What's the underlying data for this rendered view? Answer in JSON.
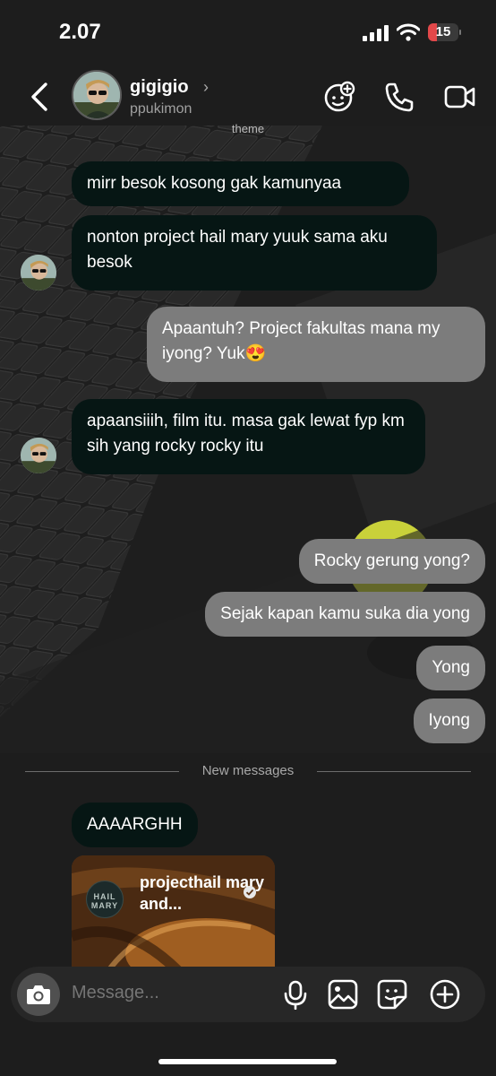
{
  "status_bar": {
    "time": "2.07",
    "battery": "15"
  },
  "header": {
    "username": "gigigio",
    "chevron": "›",
    "handle": "ppukimon"
  },
  "theme_notice": "theme",
  "messages": [
    {
      "side": "in",
      "text": "mirr besok kosong gak kamunyaa"
    },
    {
      "side": "in",
      "text": "nonton project hail mary yuuk sama aku besok"
    },
    {
      "side": "out",
      "text": "Apaantuh? Project fakultas mana my iyong? Yuk😍"
    },
    {
      "side": "in",
      "text": "apaansiiih, film itu. masa gak lewat fyp km sih yang rocky rocky itu"
    },
    {
      "side": "out",
      "text": "Rocky gerung yong?"
    },
    {
      "side": "out",
      "text": "Sejak kapan kamu suka dia yong"
    },
    {
      "side": "out",
      "text": "Yong"
    },
    {
      "side": "out",
      "text": "Iyong"
    },
    {
      "side": "in",
      "text": "AAAARGHH"
    }
  ],
  "divider": {
    "label": "New messages"
  },
  "shared_reel": {
    "title": "projecthail mary and...",
    "account_badge": "HAIL MARY",
    "verified": true
  },
  "composer": {
    "placeholder": "Message..."
  },
  "colors": {
    "incoming_bubble": "#061614",
    "outgoing_bubble": "#7c7c7c",
    "background": "#1d1d1d",
    "battery_low": "#e2484a"
  }
}
